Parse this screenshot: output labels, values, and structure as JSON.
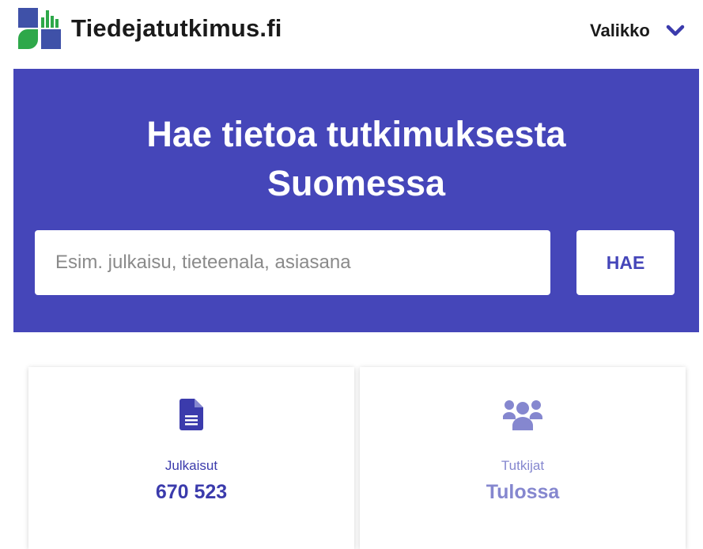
{
  "header": {
    "site_title": "Tiedejatutkimus.fi",
    "menu_label": "Valikko",
    "logo_icon": "tiedejatutkimus-logo-icon",
    "menu_icon": "chevron-down-icon"
  },
  "hero": {
    "title_line1": "Hae tietoa tutkimuksesta",
    "title_line2": "Suomessa",
    "search": {
      "placeholder": "Esim. julkaisu, tieteenala, asiasana",
      "value": "",
      "button_label": "HAE"
    }
  },
  "cards": [
    {
      "icon": "document-icon",
      "label": "Julkaisut",
      "value": "670 523",
      "color": "#3b3bac"
    },
    {
      "icon": "people-group-icon",
      "label": "Tutkijat",
      "value": "Tulossa",
      "color": "#8587cf"
    }
  ],
  "colors": {
    "brand_blue": "#4546b9",
    "logo_blue": "#3f51a8",
    "logo_green": "#2ea84a"
  }
}
